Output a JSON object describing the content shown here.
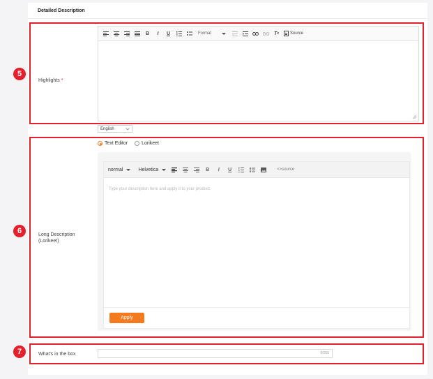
{
  "section": {
    "title": "Detailed Description"
  },
  "highlights": {
    "badge": "5",
    "label": "Highlights",
    "required_mark": "*",
    "toolbar": {
      "format_label": "Format",
      "source_label": "Source"
    },
    "language": "English"
  },
  "long_description": {
    "badge": "6",
    "label": "Long Description (Lorikeet)",
    "mode_options": [
      "Text Editor",
      "Lorikeet"
    ],
    "selected_mode": "Text Editor",
    "toolbar": {
      "size_value": "normal",
      "font_value": "Helvetica",
      "source_label": "<>source"
    },
    "placeholder": "Type your description here and apply it to your product.",
    "apply_label": "Apply"
  },
  "whats_in_box": {
    "badge": "7",
    "label": "What's in the box",
    "counter": "0/255"
  },
  "colors": {
    "accent_red": "#e3202c",
    "accent_orange": "#f47a20"
  }
}
